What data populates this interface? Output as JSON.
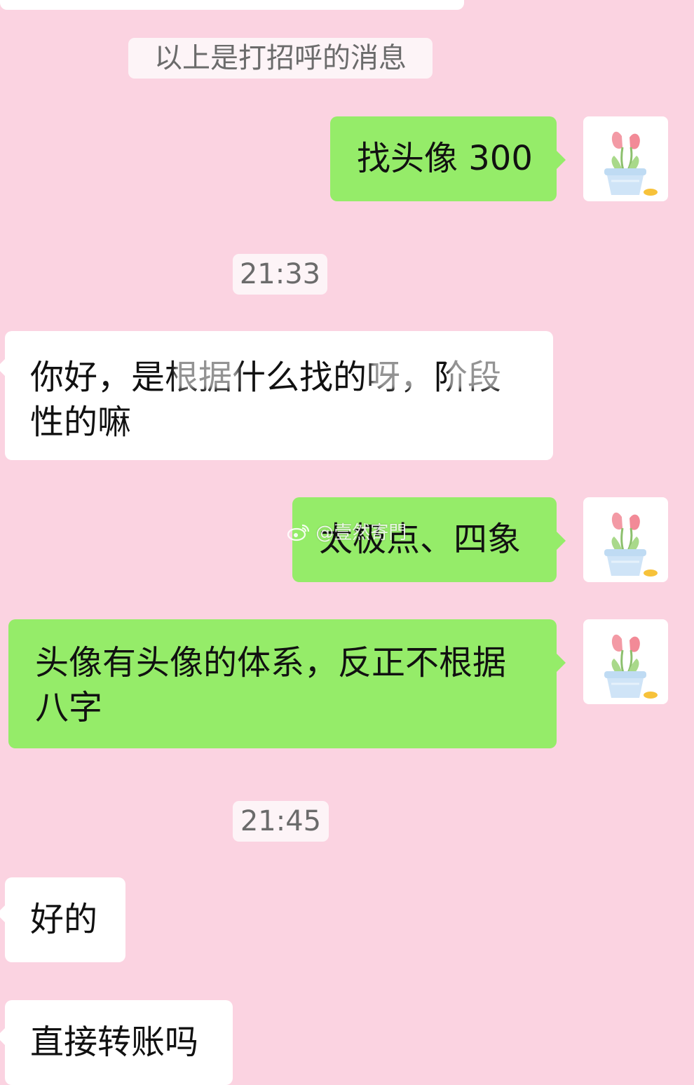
{
  "system": {
    "greeting_notice": "以上是打招呼的消息"
  },
  "timestamps": [
    "21:33",
    "21:45"
  ],
  "messages": [
    {
      "sender": "me",
      "text": "找头像 300"
    },
    {
      "sender": "other",
      "text": "你好，是根据什么找的呀，阶段性的嘛"
    },
    {
      "sender": "me",
      "text": "太极点、四象"
    },
    {
      "sender": "me",
      "text": "头像有头像的体系，反正不根据八字"
    },
    {
      "sender": "other",
      "text": "好的"
    },
    {
      "sender": "other",
      "text": "直接转账吗"
    }
  ],
  "avatar": {
    "icon": "tulip-pot-icon"
  },
  "watermark": {
    "text": "@壹然寄門",
    "icon": "weibo-icon"
  },
  "colors": {
    "background": "#fbd3e1",
    "outgoing_bubble": "#95ec69",
    "incoming_bubble": "#ffffff",
    "system_text": "#6b6b6b"
  }
}
